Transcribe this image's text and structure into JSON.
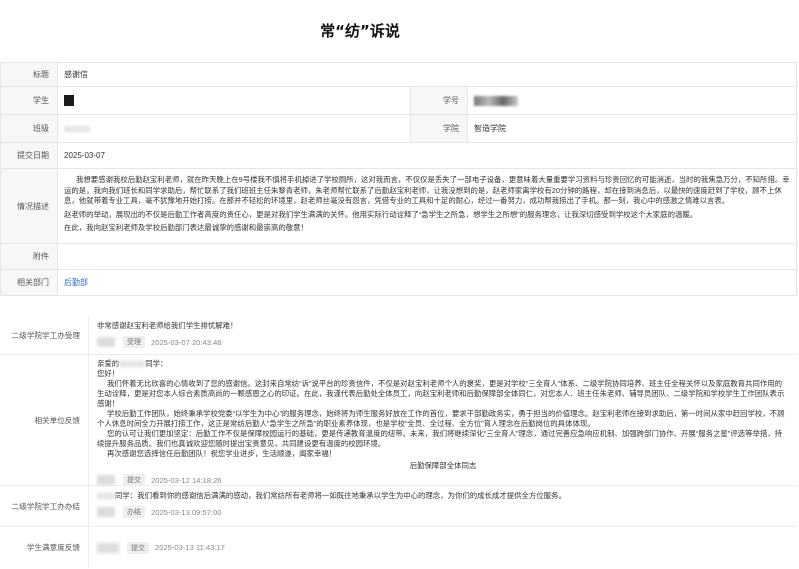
{
  "page_title": "常“纺”诉说",
  "info": {
    "rows": {
      "title": {
        "label": "标题",
        "value": "感谢信"
      },
      "student": {
        "label": "学生"
      },
      "student_no": {
        "label": "学号"
      },
      "class": {
        "label": "班级"
      },
      "college": {
        "label": "学院",
        "value": "智造学院"
      },
      "submit_date": {
        "label": "提交日期",
        "value": "2025-03-07"
      },
      "description": {
        "label": "情况描述"
      },
      "attachment": {
        "label": "附件"
      },
      "dept": {
        "label": "相关部门",
        "value": "后勤部"
      }
    },
    "description_paragraphs": [
      "我想要感谢我校后勤赵宝利老师，就在昨天晚上在9号楼我不慎将手机掉进了学校厕所，这对我而言，不仅仅是丢失了一部电子设备，更意味着大量重要学习资料与珍贵回忆的可能消逝，当时的我焦急万分，不知所措。幸运的是，我向我们班长和同学求助后，帮忙联系了我们班班主任朱黎青老师，朱老师帮忙联系了后勤赵宝利老师，让我没想到的是，赵老师家离学校有20分钟的路程，却在接到消息后，以最快的速度赶到了学校，顾不上休息，他就带着专业工具，毫不犹豫地开始打捞。在那并不轻松的环境里，赵老师丝毫没有怨言，凭借专业的工具和十足的耐心，经过一番努力，成功帮我捞出了手机。那一刻，我心中的感激之情难以言表。",
      "赵老师的举动，展现出的不仅是后勤工作者高度的责任心，更是对我们学生满满的关怀。他用实际行动诠释了“急学生之所急，想学生之所想”的服务理念，让我深切感受到学校这个大家庭的温暖。",
      "在此，我向赵宝利老师及学校后勤部门表达最诚挚的感谢和最崇高的敬意！"
    ]
  },
  "feedback": [
    {
      "label": "二级学院学工办受理",
      "text": "非常感谢赵宝利老师给我们学生排忧解难！",
      "tag": "受理",
      "time": "2025-03-07   20:43:48"
    },
    {
      "label": "相关单位反馈",
      "greeting_prefix": "亲爱的",
      "greeting_suffix": "同学：",
      "hello": "您好！",
      "paragraphs": [
        "我们怀着无比欣喜的心情收到了您的感谢信。这封来自常纺“诉”说平台的珍贵信件，不仅是对赵宝利老师个人的褒奖，更是对学校“三全育人”体系、二级学院协同培养、班主任全程关怀以及家庭教育共同作用的生动诠释，更是对您本人综合素质高尚的一颗感恩之心的印证。在此，我谨代表后勤处全体员工，向赵宝利老师和后勤保障部全体同仁，对您本人、班主任朱老师、辅导员团队、二级学院和学校学生工作团队表示感谢！",
        "学校后勤工作团队，始终秉承学校党委“以学生为中心”的服务理念，始终将为师生服务好放在工作的首位，要求干部勤政务实，勇于担当的价值理念。赵宝利老师在接到求助后，第一时间从家中赶回学校，不顾个人休息时间全力开展打捞工作，这正是常纺后勤人“急学生之所急”的职业素养体现，也是学校“全员、全过程、全方位”育人理念在后勤岗位的具体体现。",
        "您的认可让我们更加坚定：后勤工作不仅是保障校园运行的基础，更是传递教育温度的纽带。未来，我们将继续深化“三全育人”理念，通过完善应急响应机制、加强跨部门协作、开展“服务之星”评选等举措，持续提升服务品质。我们也真诚欢迎您随时提出宝贵意见，共同建设更有温度的校园环境。",
        "再次感谢您选择信任后勤团队！祝您学业进步，生活顺遂，阖家幸福！"
      ],
      "signature": "后勤保障部全体同志",
      "tag": "提交",
      "time": "2025-03-12   14:18:26"
    },
    {
      "label": "二级学院学工办办结",
      "text_suffix": "同学：我们看到你的感谢信后满满的感动，我们常纺所有老师将一如既往地秉承以学生为中心的理念，为你们的成长成才提供全方位服务。",
      "tag": "办结",
      "time": "2025-03-13   09:57:00"
    },
    {
      "label": "学生满意度反馈",
      "tag": "提交",
      "time": "2025-03-13   11:43:17"
    }
  ]
}
